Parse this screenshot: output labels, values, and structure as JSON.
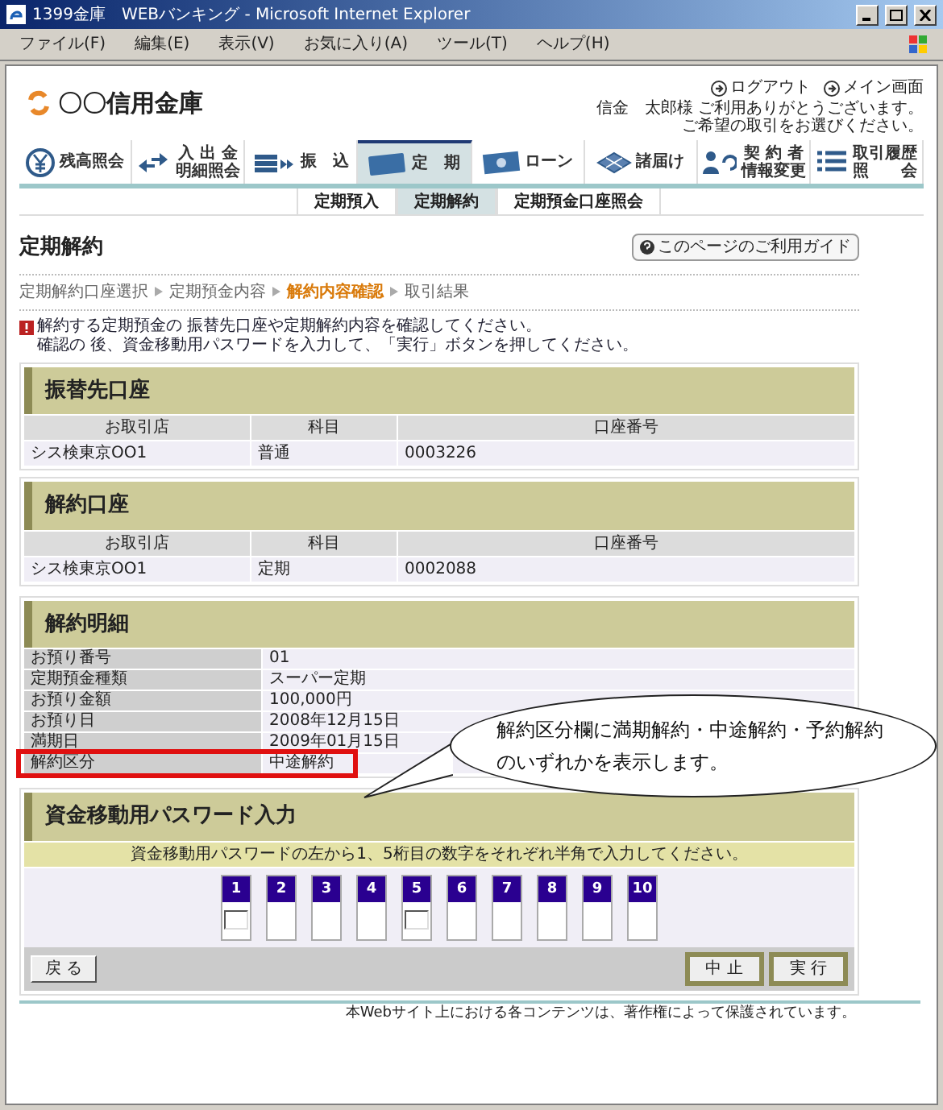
{
  "window": {
    "title": "1399金庫　WEBバンキング - Microsoft Internet Explorer"
  },
  "menu": [
    "ファイル(F)",
    "編集(E)",
    "表示(V)",
    "お気に入り(A)",
    "ツール(T)",
    "ヘルプ(H)"
  ],
  "header": {
    "bank_name": "〇〇信用金庫",
    "links": [
      "ログアウト",
      "メイン画面"
    ],
    "greeting": [
      "信金　太郎様 ご利用ありがとうございます。",
      "ご希望の取引をお選びください。"
    ]
  },
  "nav_tabs": [
    {
      "kind": "yen",
      "lines": [
        "残高照会"
      ],
      "selected": false
    },
    {
      "kind": "transfer",
      "lines": [
        "入 出 金",
        "明細照会"
      ],
      "selected": false
    },
    {
      "kind": "cards",
      "lines": [
        "振　込"
      ],
      "selected": false
    },
    {
      "kind": "fixed",
      "lines": [
        "定　期"
      ],
      "selected": true
    },
    {
      "kind": "loan",
      "lines": [
        "ローン"
      ],
      "selected": false
    },
    {
      "kind": "form",
      "lines": [
        "諸届け"
      ],
      "selected": false
    },
    {
      "kind": "person",
      "lines": [
        "契 約 者",
        "情報変更"
      ],
      "selected": false
    },
    {
      "kind": "list",
      "lines": [
        "取引履歴",
        "照　　会"
      ],
      "selected": false
    }
  ],
  "sub_tabs": [
    {
      "label": "定期預入",
      "selected": false
    },
    {
      "label": "定期解約",
      "selected": true
    },
    {
      "label": "定期預金口座照会",
      "selected": false
    }
  ],
  "page_title": "定期解約",
  "guide_button": "このページのご利用ガイド",
  "breadcrumbs": [
    {
      "label": "定期解約口座選択",
      "selected": false
    },
    {
      "label": "定期預金内容",
      "selected": false
    },
    {
      "label": "解約内容確認",
      "selected": true
    },
    {
      "label": "取引結果",
      "selected": false
    }
  ],
  "notice": [
    "解約する定期預金の 振替先口座や定期解約内容を確認してください。",
    "確認の 後、資金移動用パスワードを入力して、「実行」ボタンを押してください。"
  ],
  "account_sections": [
    {
      "title": "振替先口座",
      "columns": [
        "お取引店",
        "科目",
        "口座番号"
      ],
      "row": [
        "シス検東京OO1",
        "普通",
        "0003226"
      ]
    },
    {
      "title": "解約口座",
      "columns": [
        "お取引店",
        "科目",
        "口座番号"
      ],
      "row": [
        "シス検東京OO1",
        "定期",
        "0002088"
      ]
    }
  ],
  "details": {
    "title": "解約明細",
    "rows": [
      {
        "label": "お預り番号",
        "value": "01",
        "highlighted": false
      },
      {
        "label": "定期預金種類",
        "value": "スーパー定期",
        "highlighted": false
      },
      {
        "label": "お預り金額",
        "value": "100,000円",
        "highlighted": false
      },
      {
        "label": "お預り日",
        "value": "2008年12月15日",
        "highlighted": false
      },
      {
        "label": "満期日",
        "value": "2009年01月15日",
        "highlighted": false
      },
      {
        "label": "解約区分",
        "value": "中途解約",
        "highlighted": true
      }
    ]
  },
  "callout": "解約区分欄に満期解約・中途解約・予約解約のいずれかを表示します。",
  "password": {
    "title": "資金移動用パスワード入力",
    "instruction": "資金移動用パスワードの左から1、5桁目の数字をそれぞれ半角で入力してください。",
    "digits": [
      {
        "label": "1",
        "enabled": true
      },
      {
        "label": "2",
        "enabled": false
      },
      {
        "label": "3",
        "enabled": false
      },
      {
        "label": "4",
        "enabled": false
      },
      {
        "label": "5",
        "enabled": true
      },
      {
        "label": "6",
        "enabled": false
      },
      {
        "label": "7",
        "enabled": false
      },
      {
        "label": "8",
        "enabled": false
      },
      {
        "label": "9",
        "enabled": false
      },
      {
        "label": "10",
        "enabled": false
      }
    ]
  },
  "buttons": {
    "back": "戻 る",
    "cancel": "中 止",
    "execute": "実 行"
  },
  "footer": "本Webサイト上における各コンテンツは、著作権によって保護されています。"
}
